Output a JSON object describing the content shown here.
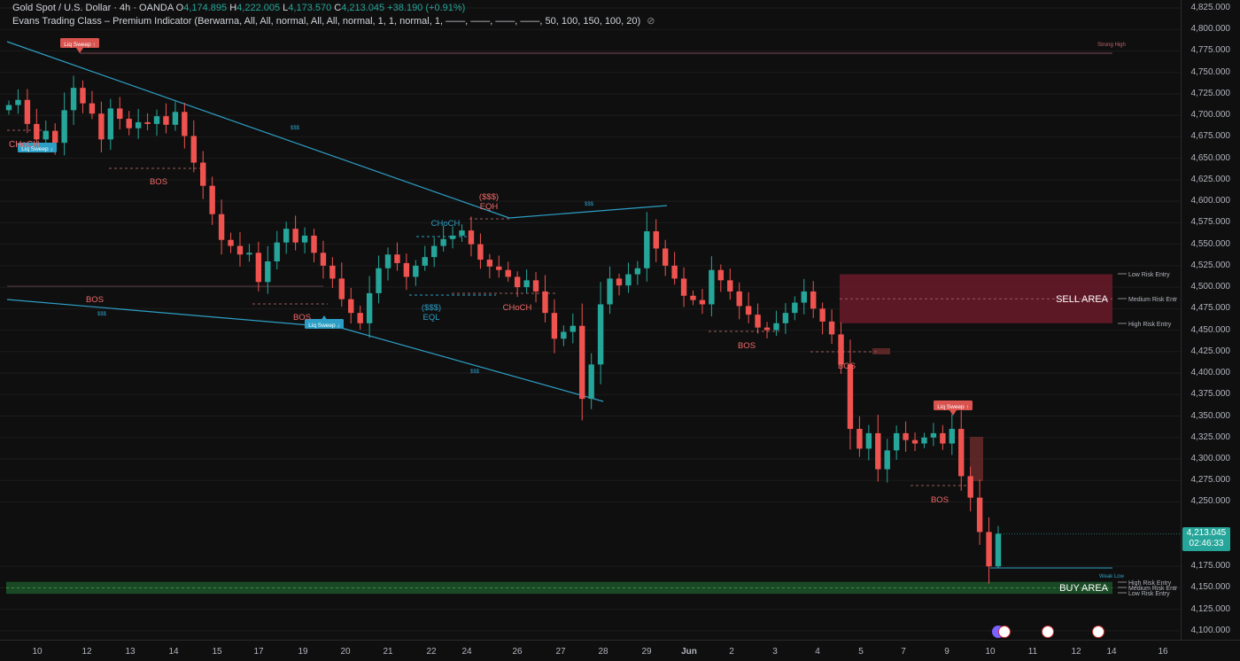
{
  "header": {
    "symbol_line": "Gold Spot / U.S. Dollar · 4h · OANDA",
    "ohlc": {
      "o_label": "O",
      "o": "4,174.895",
      "h_label": "H",
      "h": "4,222.005",
      "l_label": "L",
      "l": "4,173.570",
      "c_label": "C",
      "c": "4,213.045",
      "change": "+38.190 (+0.91%)"
    },
    "indicator_line": "Evans Trading Class – Premium Indicator (Berwarna, All, All, normal, All, All, normal, 1, 1, normal, 1, ——, ——, ——, ——, 50, 100, 150, 100, 20)"
  },
  "price_axis": {
    "ticks": [
      "4,825.000",
      "4,800.000",
      "4,775.000",
      "4,750.000",
      "4,725.000",
      "4,700.000",
      "4,675.000",
      "4,650.000",
      "4,625.000",
      "4,600.000",
      "4,575.000",
      "4,550.000",
      "4,525.000",
      "4,500.000",
      "4,475.000",
      "4,450.000",
      "4,425.000",
      "4,400.000",
      "4,375.000",
      "4,350.000",
      "4,325.000",
      "4,300.000",
      "4,275.000",
      "4,250.000",
      "4,213.115",
      "4,175.000",
      "4,150.000",
      "4,125.000",
      "4,100.000"
    ],
    "current_price": "4,213.045",
    "countdown": "02:46:33"
  },
  "time_axis": {
    "ticks": [
      "10",
      "12",
      "13",
      "14",
      "15",
      "17",
      "19",
      "20",
      "21",
      "22",
      "24",
      "26",
      "27",
      "28",
      "29",
      "Jun",
      "2",
      "3",
      "4",
      "5",
      "7",
      "9",
      "10",
      "11",
      "12",
      "14",
      "16"
    ]
  },
  "annotations": {
    "liq_sweep_up": "Liq Sweep ↑",
    "liq_sweep_down": "Liq Sweep ↓",
    "bos": "BOS",
    "choch": "CHoCH",
    "eqh_top": "($$$)",
    "eqh": "EQH",
    "eql_top": "($$$)",
    "eql": "EQL",
    "dollars": "$$$",
    "strong_high": "Strong High",
    "weak_low": "Weak Low",
    "sell_area": "SELL AREA",
    "buy_area": "BUY AREA",
    "low_risk_entry": "Low Risk Entry",
    "medium_risk_entry": "Medium Risk Entr",
    "high_risk_entry": "High Risk Entry",
    "buy_high_risk": "High Risk Entry",
    "buy_medium_risk": "Medium Risk Entr",
    "buy_low_risk": "Low Risk Entry"
  },
  "colors": {
    "up": "#26a69a",
    "down": "#ef5350",
    "trendline": "#2d9fc6",
    "sell_zone": "#6b1a2a",
    "buy_zone": "#1e5e2e"
  },
  "chart_data": {
    "type": "candlestick",
    "symbol": "XAUUSD",
    "timeframe": "4h",
    "ylim": [
      4090,
      4835
    ],
    "last": {
      "open": 4174.895,
      "high": 4222.005,
      "low": 4173.57,
      "close": 4213.045
    },
    "zones": [
      {
        "name": "SELL AREA",
        "from": 4458,
        "to": 4515
      },
      {
        "name": "BUY AREA",
        "from": 4143,
        "to": 4157
      }
    ],
    "closes": [
      4712,
      4718,
      4690,
      4672,
      4682,
      4668,
      4706,
      4732,
      4714,
      4702,
      4672,
      4708,
      4696,
      4685,
      4692,
      4690,
      4699,
      4689,
      4704,
      4676,
      4645,
      4618,
      4585,
      4555,
      4548,
      4538,
      4540,
      4506,
      4530,
      4552,
      4568,
      4552,
      4560,
      4540,
      4525,
      4510,
      4486,
      4470,
      4458,
      4493,
      4522,
      4538,
      4528,
      4512,
      4525,
      4535,
      4548,
      4556,
      4560,
      4566,
      4550,
      4532,
      4524,
      4520,
      4512,
      4500,
      4508,
      4495,
      4470,
      4440,
      4448,
      4455,
      4370,
      4410,
      4480,
      4510,
      4502,
      4515,
      4522,
      4565,
      4545,
      4525,
      4510,
      4490,
      4485,
      4480,
      4520,
      4508,
      4495,
      4478,
      4468,
      4453,
      4450,
      4458,
      4470,
      4482,
      4495,
      4475,
      4460,
      4445,
      4410,
      4335,
      4312,
      4330,
      4288,
      4310,
      4330,
      4322,
      4318,
      4325,
      4330,
      4318,
      4335,
      4280,
      4255,
      4215,
      4175,
      4213
    ]
  }
}
